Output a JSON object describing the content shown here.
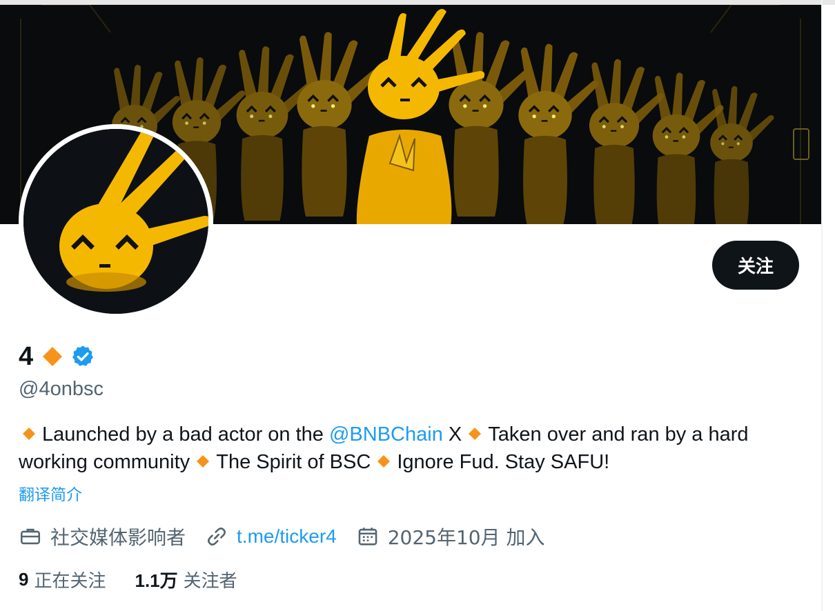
{
  "profile": {
    "display_name": "4",
    "handle": "@4onbsc",
    "follow_label": "关注",
    "bio": {
      "part1": "Launched by a bad actor on the ",
      "mention": "@BNBChain",
      "part2": " X ",
      "part3": "Taken over and ran by a hard working community ",
      "part4": "The Spirit of BSC ",
      "part5": "Ignore Fud. Stay SAFU!"
    },
    "translate_label": "翻译简介",
    "category": "社交媒体影响者",
    "website": "t.me/ticker4",
    "joined": "2025年10月 加入",
    "following_count": "9",
    "following_label": "正在关注",
    "followers_count": "1.1万",
    "followers_label": "关注者"
  },
  "icons": {
    "category": "briefcase-icon",
    "website": "link-icon",
    "joined": "calendar-icon",
    "verified": "verified-badge-icon",
    "diamond": "orange-diamond-icon"
  },
  "colors": {
    "accent": "#1d9bf0",
    "diamond": "#f7931a",
    "mascot": "#f5b800",
    "text": "#0f1419",
    "muted": "#536471",
    "button_bg": "#0f1419"
  }
}
